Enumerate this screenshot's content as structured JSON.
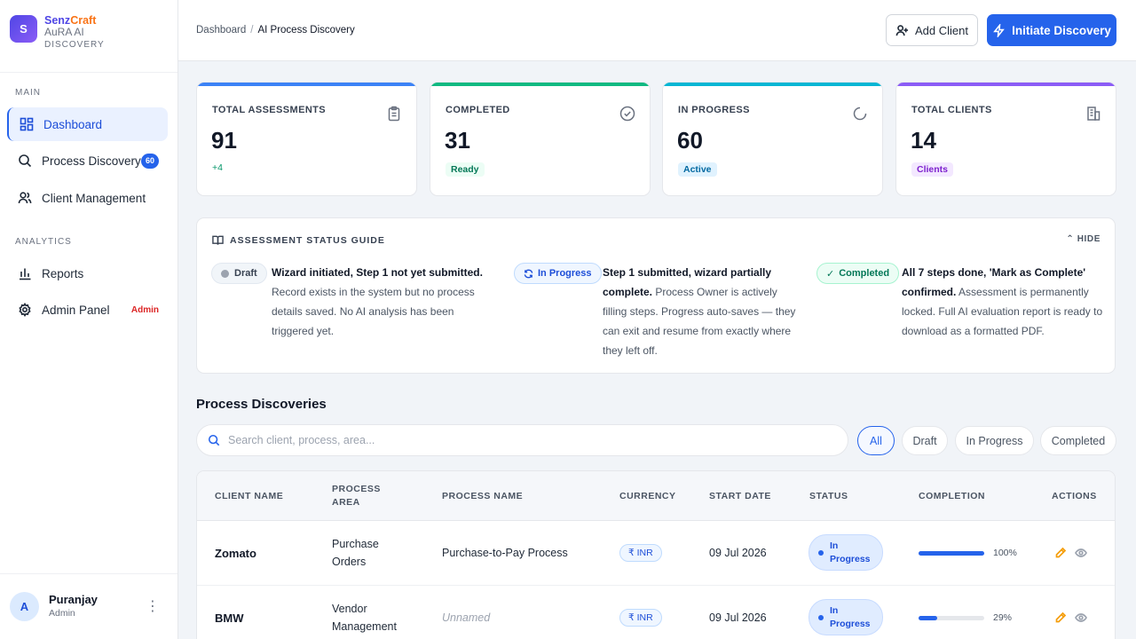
{
  "brand": {
    "logo_letter": "S",
    "name_part1": "Senz",
    "name_part2": "Craft",
    "subtitle": "AuRA AI",
    "tagline": "DISCOVERY"
  },
  "sidebar": {
    "sections": [
      {
        "label": "MAIN",
        "items": [
          {
            "label": "Dashboard",
            "icon": "grid-icon",
            "active": true
          },
          {
            "label": "Process Discovery",
            "icon": "search-icon",
            "badge": "60"
          },
          {
            "label": "Client Management",
            "icon": "users-icon"
          }
        ]
      },
      {
        "label": "ANALYTICS",
        "items": [
          {
            "label": "Reports",
            "icon": "bar-chart-icon"
          },
          {
            "label": "Admin Panel",
            "icon": "gear-icon",
            "tag": "Admin"
          }
        ]
      }
    ],
    "user": {
      "initial": "A",
      "name": "Puranjay",
      "role": "Admin"
    }
  },
  "header": {
    "breadcrumb": [
      "Dashboard",
      "AI Process Discovery"
    ],
    "add_client_label": "Add Client",
    "initiate_label": "Initiate Discovery"
  },
  "stats": [
    {
      "label": "TOTAL ASSESSMENTS",
      "value": "91",
      "sub": "+4",
      "icon": "clipboard-icon",
      "color": "#3b82f6"
    },
    {
      "label": "COMPLETED",
      "value": "31",
      "pill": "Ready",
      "icon": "check-circle-icon",
      "color": "#10b981"
    },
    {
      "label": "IN PROGRESS",
      "value": "60",
      "pill": "Active",
      "icon": "loader-icon",
      "color": "#06b6d4"
    },
    {
      "label": "TOTAL CLIENTS",
      "value": "14",
      "pill": "Clients",
      "icon": "building-icon",
      "color": "#8b5cf6"
    }
  ],
  "guide": {
    "title": "ASSESSMENT STATUS GUIDE",
    "hide_label": "HIDE",
    "items": [
      {
        "badge": "Draft",
        "bold": "Wizard initiated, Step 1 not yet submitted.",
        "text": "Record exists in the system but no process details saved. No AI analysis has been triggered yet."
      },
      {
        "badge": "In Progress",
        "bold": "Step 1 submitted, wizard partially complete.",
        "text": "Process Owner is actively filling steps. Progress auto-saves — they can exit and resume from exactly where they left off."
      },
      {
        "badge": "Completed",
        "bold": "All 7 steps done, 'Mark as Complete' confirmed.",
        "text": "Assessment is permanently locked. Full AI evaluation report is ready to download as a formatted PDF."
      }
    ]
  },
  "discoveries": {
    "title": "Process Discoveries",
    "search_placeholder": "Search client, process, area...",
    "filters": [
      "All",
      "Draft",
      "In Progress",
      "Completed"
    ],
    "columns": [
      "CLIENT NAME",
      "PROCESS AREA",
      "PROCESS NAME",
      "CURRENCY",
      "START DATE",
      "STATUS",
      "COMPLETION",
      "ACTIONS"
    ],
    "rows": [
      {
        "client": "Zomato",
        "area": "Purchase Orders",
        "process": "Purchase-to-Pay Process",
        "currency": "₹ INR",
        "start": "09 Jul 2026",
        "status": "In Progress",
        "completion": 100,
        "completion_label": "100%"
      },
      {
        "client": "BMW",
        "area": "Vendor Management",
        "process": "Unnamed",
        "currency": "₹ INR",
        "start": "09 Jul 2026",
        "status": "In Progress",
        "completion": 29,
        "completion_label": "29%"
      }
    ]
  }
}
